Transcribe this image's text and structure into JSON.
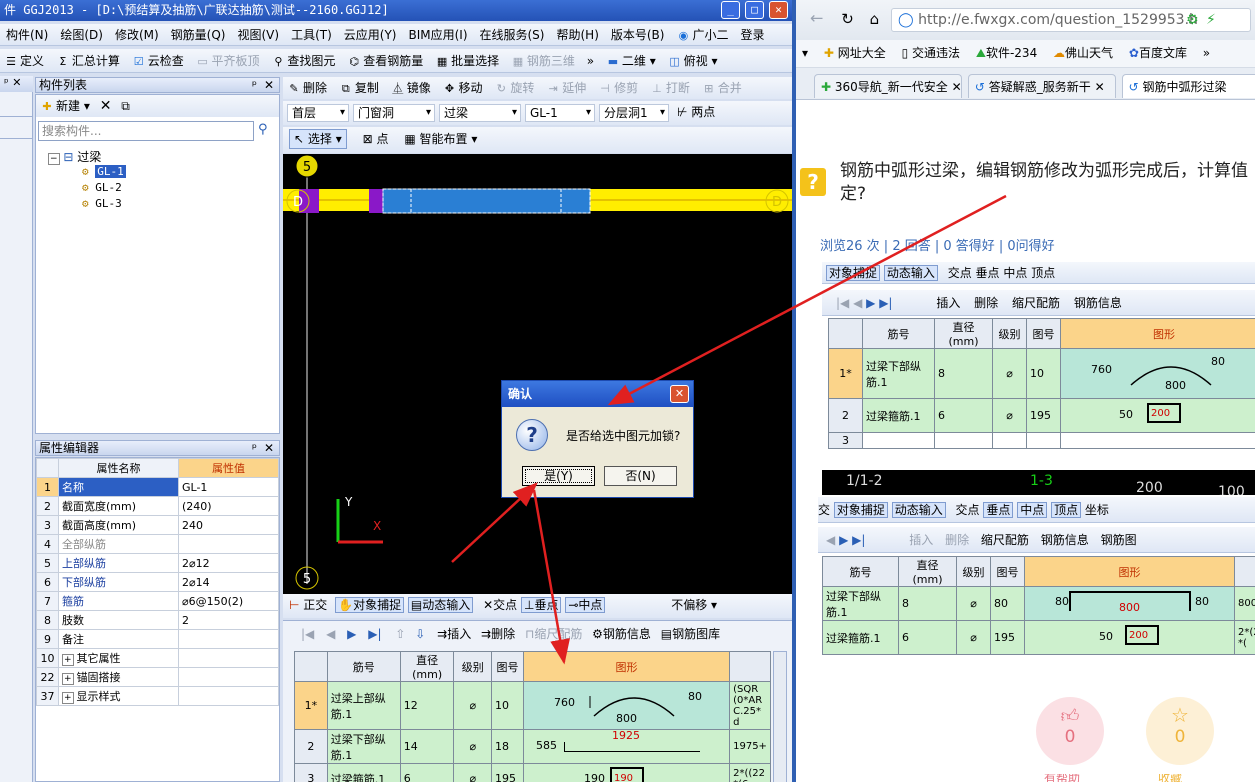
{
  "app": {
    "title": "件 GGJ2013 - [D:\\预结算及抽筋\\广联达抽筋\\测试--2160.GGJ12]",
    "win_min": "_",
    "win_max": "□",
    "win_close": "✕",
    "menu": [
      "构件(N)",
      "绘图(D)",
      "修改(M)",
      "钢筋量(Q)",
      "视图(V)",
      "工具(T)",
      "云应用(Y)",
      "BIM应用(I)",
      "在线服务(S)",
      "帮助(H)",
      "版本号(B)",
      "广小二",
      "登录"
    ],
    "toolbar1": [
      "定义",
      "汇总计算",
      "云检查",
      "平齐板顶",
      "查找图元",
      "查看钢筋量",
      "批量选择",
      "钢筋三维",
      "二维",
      "俯视"
    ],
    "toolbar_edit": [
      "删除",
      "复制",
      "镜像",
      "移动",
      "旋转",
      "延伸",
      "修剪",
      "打断",
      "合并"
    ],
    "filter": {
      "floor": "首层",
      "type": "门窗洞",
      "sub": "过梁",
      "item": "GL-1",
      "layer": "分层洞1",
      "two_point": "两点"
    },
    "select_bar": [
      "选择",
      "点",
      "智能布置"
    ],
    "component_list": {
      "title": "构件列表",
      "new": "新建",
      "search_placeholder": "搜索构件...",
      "root": "过梁",
      "items": [
        "GL-1",
        "GL-2",
        "GL-3"
      ]
    },
    "property_editor": {
      "title": "属性编辑器",
      "col_name": "属性名称",
      "col_value": "属性值",
      "rows": [
        {
          "n": "1",
          "name": "名称",
          "value": "GL-1"
        },
        {
          "n": "2",
          "name": "截面宽度(mm)",
          "value": "(240)"
        },
        {
          "n": "3",
          "name": "截面高度(mm)",
          "value": "240"
        },
        {
          "n": "4",
          "name": "全部纵筋",
          "value": ""
        },
        {
          "n": "5",
          "name": "上部纵筋",
          "value": "2⌀12"
        },
        {
          "n": "6",
          "name": "下部纵筋",
          "value": "2⌀14"
        },
        {
          "n": "7",
          "name": "箍筋",
          "value": "⌀6@150(2)"
        },
        {
          "n": "8",
          "name": "肢数",
          "value": "2"
        },
        {
          "n": "9",
          "name": "备注",
          "value": ""
        },
        {
          "n": "10",
          "name": "其它属性",
          "value": ""
        },
        {
          "n": "22",
          "name": "锚固搭接",
          "value": ""
        },
        {
          "n": "37",
          "name": "显示样式",
          "value": ""
        }
      ]
    },
    "canvas_labels": {
      "axis_5": "5",
      "axis_d": "D",
      "y": "Y",
      "x": "X"
    },
    "snap_bar": [
      "正交",
      "对象捕捉",
      "动态输入",
      "交点",
      "垂点",
      "中点",
      "不偏移"
    ],
    "rebar_bar": [
      "插入",
      "删除",
      "缩尺配筋",
      "钢筋信息",
      "钢筋图库"
    ],
    "rebar_table": {
      "headers": [
        "筋号",
        "直径(mm)",
        "级别",
        "图号",
        "图形"
      ],
      "rows": [
        {
          "n": "1*",
          "name": "过梁上部纵筋.1",
          "dia": "12",
          "grade": "⌀",
          "fig": "10",
          "s1": "760",
          "s2": "800",
          "s3": "80",
          "calc": "(SQR(0*ARC.25*d"
        },
        {
          "n": "2",
          "name": "过梁下部纵筋.1",
          "dia": "14",
          "grade": "⌀",
          "fig": "18",
          "s1": "585",
          "s2": "1925",
          "s3": "",
          "calc": "1975+"
        },
        {
          "n": "3",
          "name": "过梁箍筋.1",
          "dia": "6",
          "grade": "⌀",
          "fig": "195",
          "s1": "190",
          "s2": "190",
          "s3": "",
          "calc": "2*((22*(6."
        }
      ]
    },
    "dialog": {
      "title": "确认",
      "message": "是否给选中图元加锁?",
      "yes": "是(Y)",
      "no": "否(N)"
    }
  },
  "browser": {
    "url": "http://e.fwxgx.com/question_1529953.h",
    "bookmarks": [
      "网址大全",
      "交通违法",
      "软件-234",
      "佛山天气",
      "百度文库"
    ],
    "tabs": [
      "360导航_新一代安全",
      "答疑解惑_服务新干",
      "钢筋中弧形过梁"
    ],
    "question": "钢筋中弧形过梁，编辑钢筋修改为弧形完成后，计算值定?",
    "stats": "浏览26 次 | 2 回答 | 0 答得好 | 0问得好",
    "ss1": {
      "snap": [
        "对象捕捉",
        "动态输入",
        "交点",
        "垂点",
        "中点",
        "顶点"
      ],
      "tools": [
        "插入",
        "删除",
        "缩尺配筋",
        "钢筋信息"
      ],
      "headers": [
        "筋号",
        "直径(mm)",
        "级别",
        "图号",
        "图形"
      ],
      "rows": [
        {
          "n": "1*",
          "name": "过梁下部纵筋.1",
          "dia": "8",
          "grade": "⌀",
          "fig": "10",
          "s1": "760",
          "s2": "800",
          "s3": "80"
        },
        {
          "n": "2",
          "name": "过梁箍筋.1",
          "dia": "6",
          "grade": "⌀",
          "fig": "195",
          "s1": "50",
          "s2": "200",
          "s3": ""
        },
        {
          "n": "3",
          "name": "",
          "dia": "",
          "grade": "",
          "fig": "",
          "s1": "",
          "s2": "",
          "s3": ""
        }
      ],
      "axis": [
        "1/1-2",
        "1-3",
        "200",
        "100"
      ]
    },
    "ss2": {
      "snap": [
        "交",
        "对象捕捉",
        "动态输入",
        "交点",
        "垂点",
        "中点",
        "顶点",
        "坐标"
      ],
      "tools": [
        "插入",
        "删除",
        "缩尺配筋",
        "钢筋信息",
        "钢筋图"
      ],
      "headers": [
        "筋号",
        "直径(mm)",
        "级别",
        "图号",
        "图形"
      ],
      "rows": [
        {
          "name": "过梁下部纵筋.1",
          "dia": "8",
          "grade": "⌀",
          "fig": "80",
          "s1": "80",
          "s2": "800",
          "s3": "80",
          "calc": "800"
        },
        {
          "name": "过梁箍筋.1",
          "dia": "6",
          "grade": "⌀",
          "fig": "195",
          "s1": "50",
          "s2": "200",
          "s3": "",
          "calc": "2*(2*("
        }
      ]
    },
    "like_count": "0",
    "fav_count": "0",
    "like_label": "有帮助",
    "fav_label": "收藏"
  }
}
